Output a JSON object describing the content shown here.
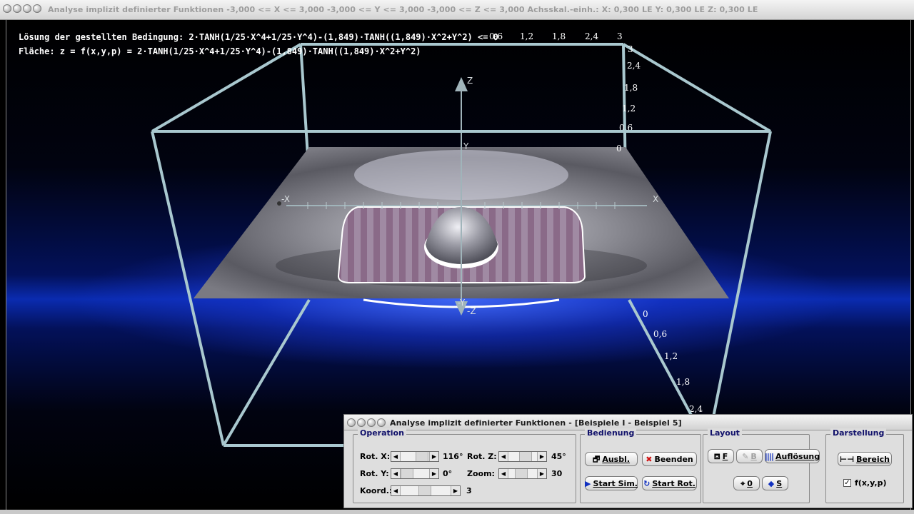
{
  "main_window": {
    "title": "Analyse implizit definierter Funktionen   -3,000 <= X <= 3,000  -3,000 <= Y <= 3,000  -3,000 <= Z <= 3,000  Achsskal.-einh.:  X: 0,300 LE    Y: 0,300 LE    Z: 0,300 LE"
  },
  "plot": {
    "formula_condition": "Lösung der gestellten Bedingung: 2·TANH(1/25·X^4+1/25·Y^4)-(1,849)·TANH((1,849)·X^2+Y^2) <= 0",
    "formula_surface": "Fläche: z = f(x,y,p) = 2·TANH(1/25·X^4+1/25·Y^4)-(1,849)·TANH((1,849)·X^2+Y^2)",
    "axis_labels": {
      "z": "Z",
      "neg_z": "-Z",
      "y": "Y",
      "neg_y": "-Y",
      "x": "X",
      "neg_x": "-X"
    },
    "top_scale_ticks": [
      "0,6",
      "1,2",
      "1,8",
      "2,4",
      "3"
    ],
    "right_scale_ticks": [
      "3",
      "2,4",
      "1,8",
      "1,2",
      "0,6",
      "0"
    ],
    "lower_scale_ticks": [
      "0",
      "0,6",
      "1,2",
      "1,8",
      "2,4"
    ],
    "colors": {
      "box": "#a9c8cf",
      "surface": "#8a8a92",
      "solution_stripe_a": "#8a6a88",
      "solution_stripe_b": "#9a7a98"
    }
  },
  "control_panel": {
    "title": "Analyse implizit definierter Funktionen - [Beispiele I - Beispiel 5]",
    "operation": {
      "title": "Operation",
      "rot_x_label": "Rot. X:",
      "rot_x_value": "116°",
      "rot_y_label": "Rot. Y:",
      "rot_y_value": "0°",
      "rot_z_label": "Rot. Z:",
      "rot_z_value": "45°",
      "zoom_label": "Zoom:",
      "zoom_value": "30",
      "koord_label": "Koord.:",
      "koord_value": "3"
    },
    "bedienung": {
      "title": "Bedienung",
      "ausbl_label": "Ausbl.",
      "beenden_label": "Beenden",
      "start_sim_label": "Start Sim.",
      "start_rot_label": "Start Rot."
    },
    "layout": {
      "title": "Layout",
      "f_label": "F",
      "b_label": "B",
      "aufloesung_label": "Auflösung",
      "zero_label": "0",
      "s_label": "S"
    },
    "darstellung": {
      "title": "Darstellung",
      "bereich_label": "Bereich",
      "fxyp_label": "f(x,y,p)",
      "fxyp_checked": "✓"
    }
  }
}
